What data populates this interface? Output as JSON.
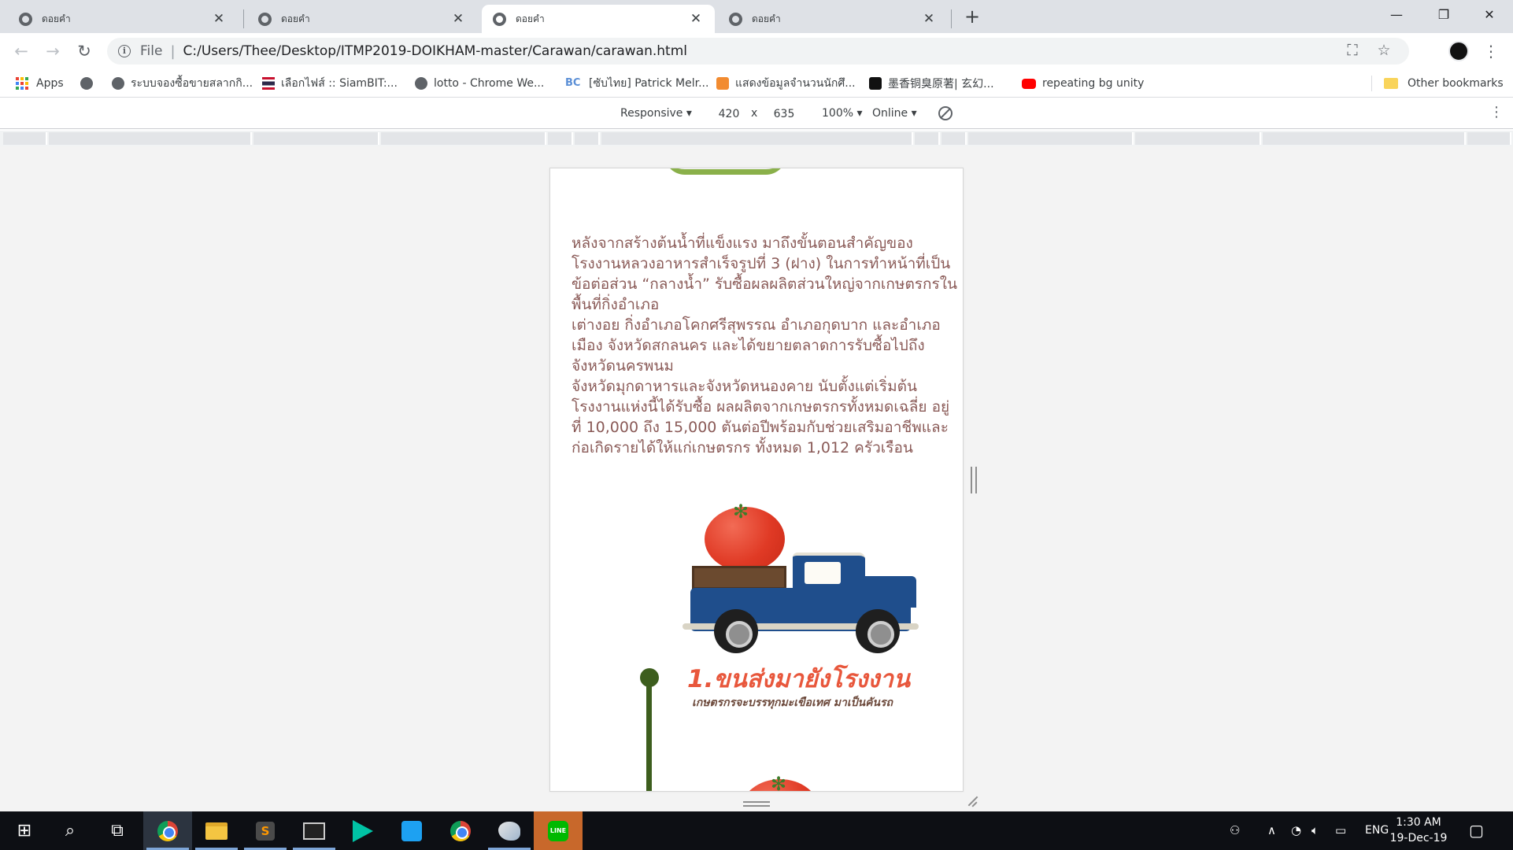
{
  "browser": {
    "tabs": [
      {
        "title": "ดอยคำ",
        "active": false
      },
      {
        "title": "ดอยคำ",
        "active": false
      },
      {
        "title": "ดอยคำ",
        "active": true
      },
      {
        "title": "ดอยคำ",
        "active": false
      }
    ],
    "new_tab_glyph": "+",
    "address": {
      "scheme": "File",
      "separator": "|",
      "url": "C:/Users/Thee/Desktop/ITMP2019-DOIKHAM-master/Carawan/carawan.html"
    },
    "bookmarks": [
      {
        "label": "Apps",
        "icon": "apps-grid-icon"
      },
      {
        "label": "",
        "icon": "globe-icon"
      },
      {
        "label": "ระบบจองซื้อขายสลากกิ...",
        "icon": "globe-icon"
      },
      {
        "label": "เลือกไฟส์ :: SiamBIT:...",
        "icon": "thai-flag-icon"
      },
      {
        "label": "lotto - Chrome We...",
        "icon": "globe-icon"
      },
      {
        "label": "[ซับไทย] Patrick Melr...",
        "icon": "bc-logo-icon"
      },
      {
        "label": "แสดงข้อมูลจำนวนนักศึ...",
        "icon": "orange-app-icon"
      },
      {
        "label": "墨香铜臭原著| 玄幻...",
        "icon": "dark-logo-icon"
      },
      {
        "label": "repeating bg unity",
        "icon": "youtube-icon"
      },
      {
        "label": "Other bookmarks",
        "icon": "folder-icon"
      }
    ]
  },
  "devtools": {
    "device": "Responsive",
    "width": "420",
    "times": "x",
    "height": "635",
    "zoom": "100%",
    "network": "Online"
  },
  "page": {
    "paragraphs": [
      "หลังจากสร้างต้นน้ำที่แข็งแรง มาถึงขั้นตอนสำคัญของโรงงานหลวงอาหารสำเร็จรูปที่ 3 (ฝาง) ในการทำหน้าที่เป็นข้อต่อส่วน “กลางน้ำ” รับซื้อผลผลิตส่วนใหญ่จากเกษตรกรในพื้นที่กิ่งอำเภอ",
      "เต่างอย กิ่งอำเภอโคกศรีสุพรรณ อำเภอกุดบาก และอำเภอเมือง จังหวัดสกลนคร และได้ขยายตลาดการรับซื้อไปถึงจังหวัดนครพนม",
      "จังหวัดมุกดาหารและจังหวัดหนองคาย นับตั้งแต่เริ่มต้นโรงงานแห่งนี้ได้รับซื้อ ผลผลิตจากเกษตรกรทั้งหมดเฉลี่ย อยู่ที่ 10,000 ถึง 15,000 ตันต่อปีพร้อมกับช่วยเสริมอาชีพและก่อเกิดรายได้ให้แก่เกษตรกร ทั้งหมด 1,012 ครัวเรือน"
    ],
    "step_title": "1.ขนส่งมายังโรงงาน",
    "step_subtitle": "เกษตรกรจะบรรทุกมะเขือเทศ มาเป็นคันรถ"
  },
  "taskbar": {
    "apps": [
      "chrome",
      "file-explorer",
      "sublime-text",
      "terminal",
      "media-player",
      "twitter",
      "chrome",
      "paint",
      "line"
    ],
    "language": "ENG",
    "time": "1:30 AM",
    "date": "19-Dec-19"
  },
  "colors": {
    "page_text": "#8a5a57",
    "step_title": "#e8573c",
    "truck_blue": "#1f4e8c",
    "tomato_red": "#e03a25",
    "pole_green": "#3d5e1e"
  }
}
